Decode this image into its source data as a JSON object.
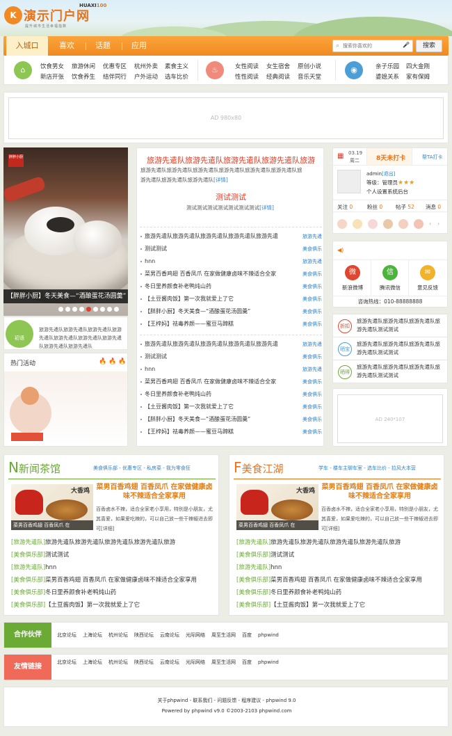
{
  "brand": {
    "logo_mark": "K",
    "name": "演示门户网",
    "badge_prefix": "HUAXI",
    "badge_num": "100",
    "sub": "提升城市生活幸福指数"
  },
  "nav": {
    "items": [
      "入城口",
      "喜欢",
      "话题",
      "应用"
    ]
  },
  "search": {
    "placeholder": "搜索你喜欢的",
    "button": "搜索"
  },
  "categories": {
    "group1": [
      "饮食男女",
      "旅游休闲",
      "优惠专区",
      "杭州外卖",
      "素食主义",
      "新店开张",
      "饮食养生",
      "结伴同行",
      "户外运动",
      "选车比价"
    ],
    "group2": [
      "女性阅读",
      "女生宿舍",
      "原创小说",
      "性性阅读",
      "经典阅读",
      "音乐天堂"
    ],
    "group3": [
      "亲子乐园",
      "四大金刚",
      "婆媳关系",
      "家有保姆"
    ]
  },
  "ad_top": "AD 980x80",
  "slider": {
    "tag": "胖胖小厨",
    "caption": "【胖胖小厨】冬天美食—“酒酿蛋花汤圆羹”",
    "active_dot": 4,
    "dot_count": 9
  },
  "headline1": {
    "title": "旅游先遣队旅游先遣队旅游先遣队旅游先遣队旅游",
    "desc1": "旅游先遣队旅游先遣队旅游先遣队旅游先遣队旅游先遣队旅游先遣队旅",
    "desc2": "游先遣队旅游先遣队旅游先遣队",
    "more": "[详情]"
  },
  "headline2": {
    "title": "测试测试",
    "desc": "测试测试测试测试测试测试测试",
    "more": "[详情]"
  },
  "list1": [
    {
      "title": "旅游先遣队旅游先遣队旅游先遣队旅游先遣队旅游先遣",
      "cat": "旅游先遣"
    },
    {
      "title": "测试测试",
      "cat": "美食俱乐"
    },
    {
      "title": "hnn",
      "cat": "旅游先遣"
    },
    {
      "title": "菜男百香鸡翅 百香凤爪 在家做健康卤味不辣适合全家",
      "cat": "美食俱乐"
    },
    {
      "title": "冬日里养颜食补老鸭炖山药",
      "cat": "美食俱乐"
    },
    {
      "title": "【土豆酱肉饭】第一次我就爱上了它",
      "cat": "美食俱乐"
    },
    {
      "title": "【胖胖小厨】冬天美食—“酒酿蛋花汤圆羹”",
      "cat": "美食俱乐"
    },
    {
      "title": "【王梓妈】祛毒养颜——蜜豆马蹄糕",
      "cat": "美食俱乐"
    }
  ],
  "list2": [
    {
      "title": "旅游先遣队旅游先遣队旅游先遣队旅游先遣队旅游先遣",
      "cat": "旅游先遣"
    },
    {
      "title": "测试测试",
      "cat": "美食俱乐"
    },
    {
      "title": "hnn",
      "cat": "旅游先遣"
    },
    {
      "title": "菜男百香鸡翅 百香凤爪 在家做健康卤味不辣适合全家",
      "cat": "美食俱乐"
    },
    {
      "title": "冬日里养颜食补老鸭炖山药",
      "cat": "美食俱乐"
    },
    {
      "title": "【土豆酱肉饭】第一次我就爱上了它",
      "cat": "美食俱乐"
    },
    {
      "title": "【胖胖小厨】冬天美食—“酒酿蛋花汤圆羹”",
      "cat": "美食俱乐"
    },
    {
      "title": "【王梓妈】祛毒养颜——蜜豆马蹄糕",
      "cat": "美食俱乐"
    }
  ],
  "small_block": {
    "logo": "初语",
    "text": "旅游先遣队旅游先遣队旅游先遣队旅游先遣队旅游先遣队旅游先遣队旅游先遣队旅游先遣队旅游先遣队"
  },
  "hot": {
    "title": "热门活动"
  },
  "user": {
    "date": "03.19",
    "weekday": "周二",
    "checkin": "8天未打卡",
    "checkin_help": "帮TA打卡",
    "name": "admin",
    "logout": "[退出]",
    "level_label": "等级：管理员",
    "backend": "个人设置系统后台",
    "stats": [
      {
        "label": "关注",
        "value": "0"
      },
      {
        "label": "粉丝",
        "value": "0"
      },
      {
        "label": "帖子",
        "value": "52"
      },
      {
        "label": "消息",
        "value": "0"
      }
    ]
  },
  "share": [
    {
      "label": "新浪微博",
      "color": "#e0452f",
      "glyph": "微"
    },
    {
      "label": "腾讯微信",
      "color": "#4bb43a",
      "glyph": "信"
    },
    {
      "label": "意见反馈",
      "color": "#f2b32a",
      "glyph": "✉"
    }
  ],
  "hotline": "咨询热线：010-88888888",
  "hot_items": [
    {
      "badge": "折扣",
      "color": "#e0452f",
      "text": "旅游先遣队旅游先遣队旅游先遣队旅游先遣队测试测试"
    },
    {
      "badge": "晒宝",
      "color": "#4a9fd8",
      "text": "旅游先遣队旅游先遣队旅游先遣队旅游先遣队测试测试"
    },
    {
      "badge": "晒得",
      "color": "#6aaa35",
      "text": "旅游先遣队旅游先遣队旅游先遣队旅游先遣队测试测试"
    }
  ],
  "ad_right": "AD 240*107",
  "section1": {
    "logo_n": "N",
    "logo": "新闻茶馆",
    "links": "美食俱乐部 - 优惠专区 - 私房菜 - 我为零食狂",
    "img_cap": "菜男百香鸡翅 百香凤爪 在",
    "img_cal": "大香鸡",
    "headline": "菜男百香鸡翅 百香凤爪 在家做健康卤味不辣适合全家享用",
    "para": "百香卤水不辣，适合全家老小享用，特别是小朋友，尤其喜爱，如果爱吃辣的，可以自己放一些干辣椒进去即可[详细]",
    "list": [
      {
        "k": "[旅游先遣队]",
        "t": "旅游先遣队旅游先遣队旅游先遣队旅游先遣队旅游"
      },
      {
        "k": "[美食俱乐部]",
        "t": "测试测试"
      },
      {
        "k": "[旅游先遣队]",
        "t": "hnn"
      },
      {
        "k": "[美食俱乐部]",
        "t": "菜男百香鸡翅 百香凤爪 在家做健康卤味不辣适合全家享用"
      },
      {
        "k": "[美食俱乐部]",
        "t": "冬日里养颜食补老鸭炖山药"
      },
      {
        "k": "[美食俱乐部]",
        "t": "【土豆酱肉饭】第一次我就爱上了它"
      }
    ]
  },
  "section2": {
    "logo_n": "F",
    "logo": "美食江湖",
    "links": "学车 - 楼车主聊车室 - 选车比价 - 拉风大本营",
    "img_cap": "菜男百香鸡翅 百香凤爪 在",
    "img_cal": "大香鸡",
    "headline": "菜男百香鸡翅 百香凤爪 在家做健康卤味不辣适合全家享用",
    "para": "百香卤水不辣，适合全家老小享用，特别是小朋友，尤其喜爱，如果爱吃辣的，可以自己放一些干辣椒进去即可[详细]",
    "list": [
      {
        "k": "[旅游先遣队]",
        "t": "旅游先遣队旅游先遣队旅游先遣队旅游先遣队旅游"
      },
      {
        "k": "[美食俱乐部]",
        "t": "测试测试"
      },
      {
        "k": "[旅游先遣队]",
        "t": "hnn"
      },
      {
        "k": "[美食俱乐部]",
        "t": "菜男百香鸡翅 百香凤爪 在家做健康卤味不辣适合全家享用"
      },
      {
        "k": "[美食俱乐部]",
        "t": "冬日里养颜食补老鸭炖山药"
      },
      {
        "k": "[美食俱乐部]",
        "t": "【土豆酱肉饭】第一次我就爱上了它"
      }
    ]
  },
  "partners": {
    "label": "合作伙伴",
    "links": [
      "北京论坛",
      "上海论坛",
      "杭州论坛",
      "陕西论坛",
      "云南论坛",
      "光际网络",
      "周至生活网",
      "百度",
      "phpwind"
    ]
  },
  "friends": {
    "label": "友情链接",
    "links": [
      "北京论坛",
      "上海论坛",
      "杭州论坛",
      "陕西论坛",
      "云南论坛",
      "光际网络",
      "周至生活网",
      "百度",
      "phpwind"
    ]
  },
  "footer": {
    "line1": "关于phpwind - 联系我们 - 问题反馈 - 程序建议 - phpwind 9.0",
    "line2": "Powered by phpwind v9.0 ©2003-2103 phpwind.com"
  },
  "colors": {
    "orange": "#f08a20",
    "green": "#6aaa35",
    "red": "#e2361e",
    "blue": "#2c80c8"
  }
}
